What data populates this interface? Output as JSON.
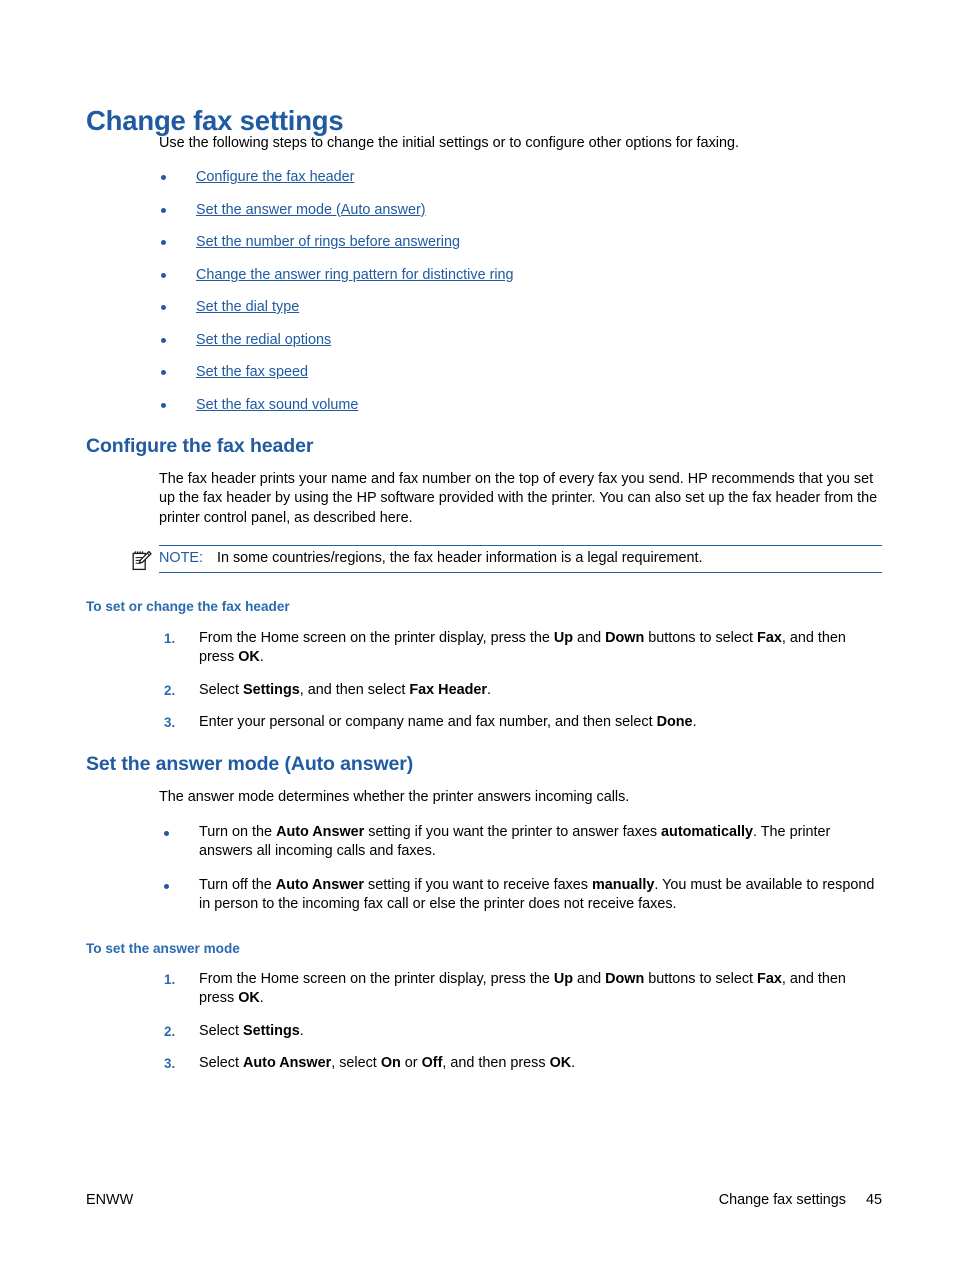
{
  "page": {
    "title": "Change fax settings",
    "intro": "Use the following steps to change the initial settings or to configure other options for faxing."
  },
  "toc_links": [
    {
      "label": "Configure the fax header"
    },
    {
      "label": "Set the answer mode (Auto answer)"
    },
    {
      "label": "Set the number of rings before answering"
    },
    {
      "label": "Change the answer ring pattern for distinctive ring"
    },
    {
      "label": "Set the dial type"
    },
    {
      "label": "Set the redial options"
    },
    {
      "label": "Set the fax speed"
    },
    {
      "label": "Set the fax sound volume"
    }
  ],
  "section_fax_header": {
    "heading": "Configure the fax header",
    "body": "The fax header prints your name and fax number on the top of every fax you send. HP recommends that you set up the fax header by using the HP software provided with the printer. You can also set up the fax header from the printer control panel, as described here.",
    "note": {
      "label": "NOTE:",
      "text": "In some countries/regions, the fax header information is a legal requirement.",
      "icon": "note-pencil-icon"
    },
    "procedure_heading": "To set or change the fax header",
    "steps": [
      {
        "number": "1.",
        "parts": [
          {
            "t": "From the Home screen on the printer display, press the ",
            "b": false
          },
          {
            "t": "Up",
            "b": true
          },
          {
            "t": " and ",
            "b": false
          },
          {
            "t": "Down",
            "b": true
          },
          {
            "t": " buttons to select ",
            "b": false
          },
          {
            "t": "Fax",
            "b": true
          },
          {
            "t": ", and then press ",
            "b": false
          },
          {
            "t": "OK",
            "b": true
          },
          {
            "t": ".",
            "b": false
          }
        ]
      },
      {
        "number": "2.",
        "parts": [
          {
            "t": "Select ",
            "b": false
          },
          {
            "t": "Settings",
            "b": true
          },
          {
            "t": ", and then select ",
            "b": false
          },
          {
            "t": "Fax Header",
            "b": true
          },
          {
            "t": ".",
            "b": false
          }
        ]
      },
      {
        "number": "3.",
        "parts": [
          {
            "t": "Enter your personal or company name and fax number, and then select ",
            "b": false
          },
          {
            "t": "Done",
            "b": true
          },
          {
            "t": ".",
            "b": false
          }
        ]
      }
    ]
  },
  "section_answer_mode": {
    "heading": "Set the answer mode (Auto answer)",
    "body": "The answer mode determines whether the printer answers incoming calls.",
    "bullets": [
      {
        "parts": [
          {
            "t": "Turn on the ",
            "b": false
          },
          {
            "t": "Auto Answer",
            "b": true
          },
          {
            "t": " setting if you want the printer to answer faxes ",
            "b": false
          },
          {
            "t": "automatically",
            "b": true
          },
          {
            "t": ". The printer answers all incoming calls and faxes.",
            "b": false
          }
        ]
      },
      {
        "parts": [
          {
            "t": "Turn off the ",
            "b": false
          },
          {
            "t": "Auto Answer",
            "b": true
          },
          {
            "t": " setting if you want to receive faxes ",
            "b": false
          },
          {
            "t": "manually",
            "b": true
          },
          {
            "t": ". You must be available to respond in person to the incoming fax call or else the printer does not receive faxes.",
            "b": false
          }
        ]
      }
    ],
    "procedure_heading": "To set the answer mode",
    "steps": [
      {
        "number": "1.",
        "parts": [
          {
            "t": "From the Home screen on the printer display, press the ",
            "b": false
          },
          {
            "t": "Up",
            "b": true
          },
          {
            "t": " and ",
            "b": false
          },
          {
            "t": "Down",
            "b": true
          },
          {
            "t": " buttons to select ",
            "b": false
          },
          {
            "t": "Fax",
            "b": true
          },
          {
            "t": ", and then press ",
            "b": false
          },
          {
            "t": "OK",
            "b": true
          },
          {
            "t": ".",
            "b": false
          }
        ]
      },
      {
        "number": "2.",
        "parts": [
          {
            "t": "Select ",
            "b": false
          },
          {
            "t": "Settings",
            "b": true
          },
          {
            "t": ".",
            "b": false
          }
        ]
      },
      {
        "number": "3.",
        "parts": [
          {
            "t": "Select ",
            "b": false
          },
          {
            "t": "Auto Answer",
            "b": true
          },
          {
            "t": ", select ",
            "b": false
          },
          {
            "t": "On",
            "b": true
          },
          {
            "t": " or ",
            "b": false
          },
          {
            "t": "Off",
            "b": true
          },
          {
            "t": ", and then press ",
            "b": false
          },
          {
            "t": "OK",
            "b": true
          },
          {
            "t": ".",
            "b": false
          }
        ]
      }
    ]
  },
  "footer": {
    "left": "ENWW",
    "chapter": "Change fax settings",
    "page_number": "45"
  },
  "colors": {
    "heading_blue": "#205AA0",
    "link_blue": "#205AA0",
    "rule_blue": "#1F5FA2",
    "text_black": "#000000"
  }
}
